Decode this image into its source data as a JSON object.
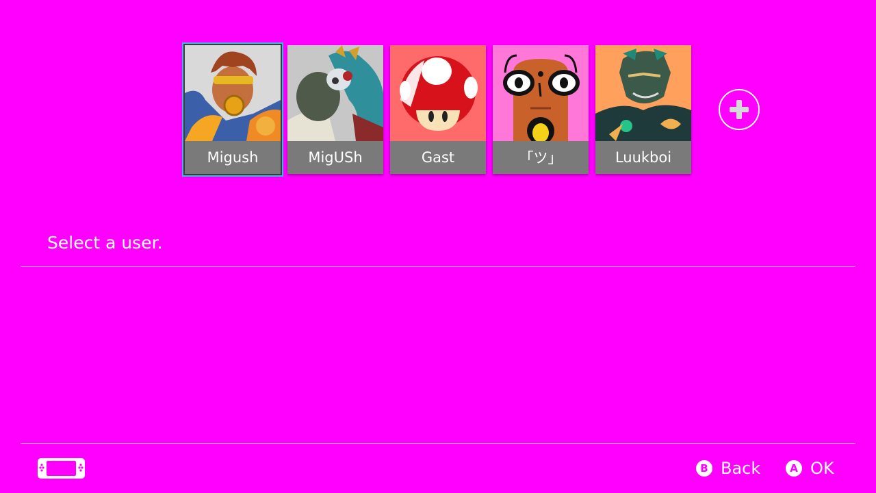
{
  "users": [
    {
      "name": "Migush",
      "selected": true,
      "avatar_bg": "#d8d8d8",
      "avatar": "brawler-icon"
    },
    {
      "name": "MigUSh",
      "selected": false,
      "avatar_bg": "#c5c5c5",
      "avatar": "masked-warrior-icon"
    },
    {
      "name": "Gast",
      "selected": false,
      "avatar_bg": "#ff6a6a",
      "avatar": "mushroom-icon"
    },
    {
      "name": "「ツ」",
      "selected": false,
      "avatar_bg": "#ff77d9",
      "avatar": "mask-face-icon"
    },
    {
      "name": "Luukboi",
      "selected": false,
      "avatar_bg": "#ffa15c",
      "avatar": "villain-icon"
    }
  ],
  "add_user": {
    "icon": "plus-icon"
  },
  "prompt": "Select a user.",
  "footer": {
    "console_icon": "handheld-console-icon",
    "back": {
      "glyph": "B",
      "label": "Back"
    },
    "ok": {
      "glyph": "A",
      "label": "OK"
    }
  },
  "colors": {
    "background": "#ff00ff",
    "selection": "#3ab8e8",
    "name_bar": "#7a7a7a"
  }
}
